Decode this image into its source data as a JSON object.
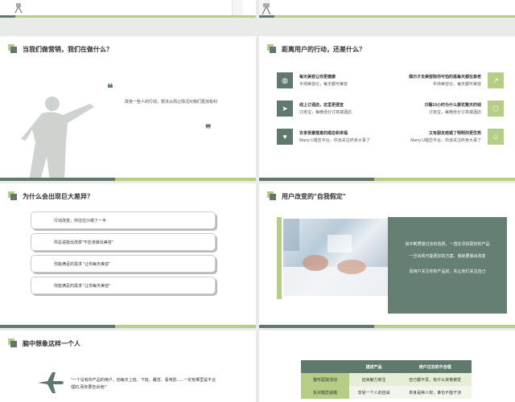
{
  "colors": {
    "dark_green": "#5f7a6d",
    "light_green": "#b5cd85",
    "bg": "#e9ebe9"
  },
  "slide1": {
    "title": "当我们做营销，我们在做什么？",
    "quote": "改变一些人的行动，想法从而让情况对我们更加有利"
  },
  "slide2": {
    "title": "距离用户的行动，还差什么？",
    "left_items": [
      {
        "heading": "每天美容让你更健康",
        "text": "手持美容仪，每天都可美容",
        "icon": "globe-icon"
      },
      {
        "heading": "线上订酒店，这里更便宜",
        "text": "订房宝，每晚低价订高端酒店",
        "icon": "paper-plane-icon"
      },
      {
        "heading": "去享受最惬意的婚恋和幸福",
        "text": "Marry U婚恋平台，你该关注终身大事了",
        "icon": "lightbulb-icon"
      }
    ],
    "right_items": [
      {
        "heading": "偶尔才去美容院你可怕的是每天都在衰老",
        "text": "手持美容仪，每天都可美容",
        "icon": "chart-icon"
      },
      {
        "heading": "只睡10小时为什么要花整天的钱",
        "text": "订房宝，每晚低价订高端酒店",
        "icon": "cube-icon"
      },
      {
        "heading": "又有朋友结婚了明明你更优秀",
        "text": "Marry U婚恋平台，你该关注终身大事了",
        "icon": "people-icon"
      }
    ]
  },
  "slide3": {
    "title": "为什么会出现巨大差异？",
    "items": [
      "行动改变，你往往只做了一半",
      "你总说能出改变\"不应该做出美容\"",
      "你能满足的需求 \"让你每天美容\"",
      "你能满足的需求 \"让你每天美容\""
    ]
  },
  "slide4": {
    "title": "用户改变的\"自我假定\"",
    "text1": "如不断质疑过去的选择，一直在寻找更好的产品",
    "text2": "一旦出现可能更好的方案，我就要做出改变",
    "text3": "而用户关注你的产品前，先让他们关注自己"
  },
  "slide5": {
    "title": "脑中想象这样一个人",
    "quote": "\"一个没有你产品的用户，他每天上班、下班、睡觉、看电影......一定有哪里是不合理的,而你要告诉他!\""
  },
  "slide6": {
    "headers": [
      "描述产品",
      "用户过去的不合理"
    ],
    "rows": [
      [
        "整形医院活动",
        "迎来魅力新生",
        "自己都不爱，有什么资格被爱"
      ],
      [
        "反对婚恋逼婚",
        "享受一个人的自由",
        "单身是种人权，谁也不能干涉"
      ]
    ]
  }
}
